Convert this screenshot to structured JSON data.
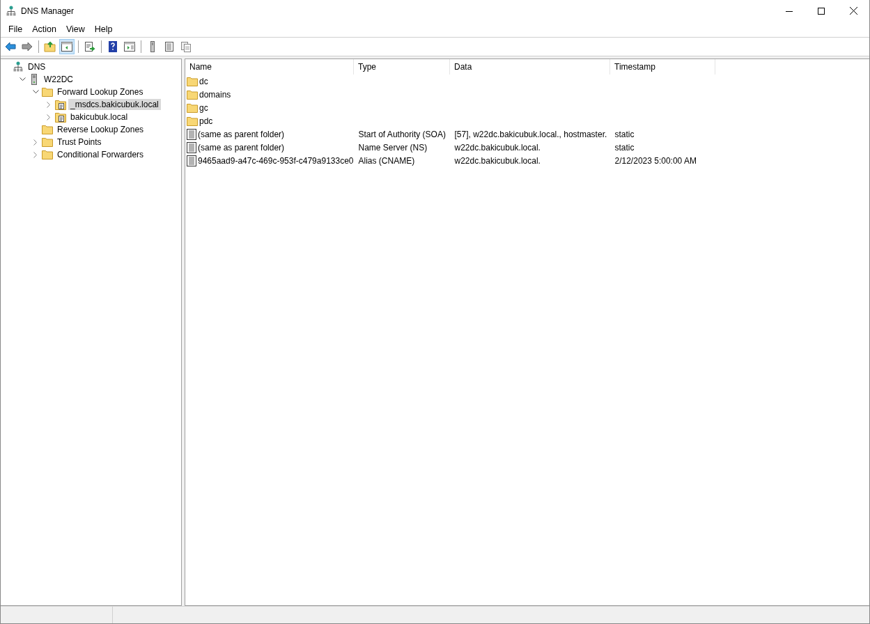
{
  "window": {
    "title": "DNS Manager"
  },
  "menu": [
    "File",
    "Action",
    "View",
    "Help"
  ],
  "toolbar": [
    {
      "kind": "back",
      "pressed": false
    },
    {
      "kind": "forward",
      "pressed": false
    },
    {
      "kind": "sep"
    },
    {
      "kind": "up",
      "pressed": false
    },
    {
      "kind": "tree",
      "pressed": true
    },
    {
      "kind": "sep"
    },
    {
      "kind": "export",
      "pressed": false
    },
    {
      "kind": "sep"
    },
    {
      "kind": "help",
      "pressed": false
    },
    {
      "kind": "action-pane",
      "pressed": false
    },
    {
      "kind": "sep"
    },
    {
      "kind": "server",
      "pressed": false
    },
    {
      "kind": "list",
      "pressed": false
    },
    {
      "kind": "copy",
      "pressed": false
    }
  ],
  "tree": [
    {
      "label": "DNS",
      "kind": "dns",
      "selected": false,
      "children": [
        {
          "label": "W22DC",
          "kind": "server",
          "expanded": true,
          "selected": false,
          "children": [
            {
              "label": "Forward Lookup Zones",
              "kind": "folder",
              "expanded": true,
              "selected": false,
              "children": [
                {
                  "label": "_msdcs.bakicubuk.local",
                  "kind": "zone",
                  "expanded": false,
                  "selected": true
                },
                {
                  "label": "bakicubuk.local",
                  "kind": "zone",
                  "expanded": false,
                  "selected": false
                }
              ]
            },
            {
              "label": "Reverse Lookup Zones",
              "kind": "folder",
              "selected": false
            },
            {
              "label": "Trust Points",
              "kind": "folder",
              "expanded": false,
              "selected": false
            },
            {
              "label": "Conditional Forwarders",
              "kind": "folder",
              "expanded": false,
              "selected": false
            }
          ]
        }
      ]
    }
  ],
  "table": {
    "columns": [
      "Name",
      "Type",
      "Data",
      "Timestamp"
    ],
    "rows": [
      {
        "kind": "folder",
        "cells": [
          "dc",
          "",
          "",
          ""
        ]
      },
      {
        "kind": "folder",
        "cells": [
          "domains",
          "",
          "",
          ""
        ]
      },
      {
        "kind": "folder",
        "cells": [
          "gc",
          "",
          "",
          ""
        ]
      },
      {
        "kind": "folder",
        "cells": [
          "pdc",
          "",
          "",
          ""
        ]
      },
      {
        "kind": "record",
        "cells": [
          "(same as parent folder)",
          "Start of Authority (SOA)",
          "[57], w22dc.bakicubuk.local., hostmaster.",
          "static"
        ]
      },
      {
        "kind": "record",
        "cells": [
          "(same as parent folder)",
          "Name Server (NS)",
          "w22dc.bakicubuk.local.",
          "static"
        ]
      },
      {
        "kind": "record",
        "cells": [
          "9465aad9-a47c-469c-953f-c479a9133ce0",
          "Alias (CNAME)",
          "w22dc.bakicubuk.local.",
          "2/12/2023 5:00:00 AM"
        ]
      }
    ]
  }
}
